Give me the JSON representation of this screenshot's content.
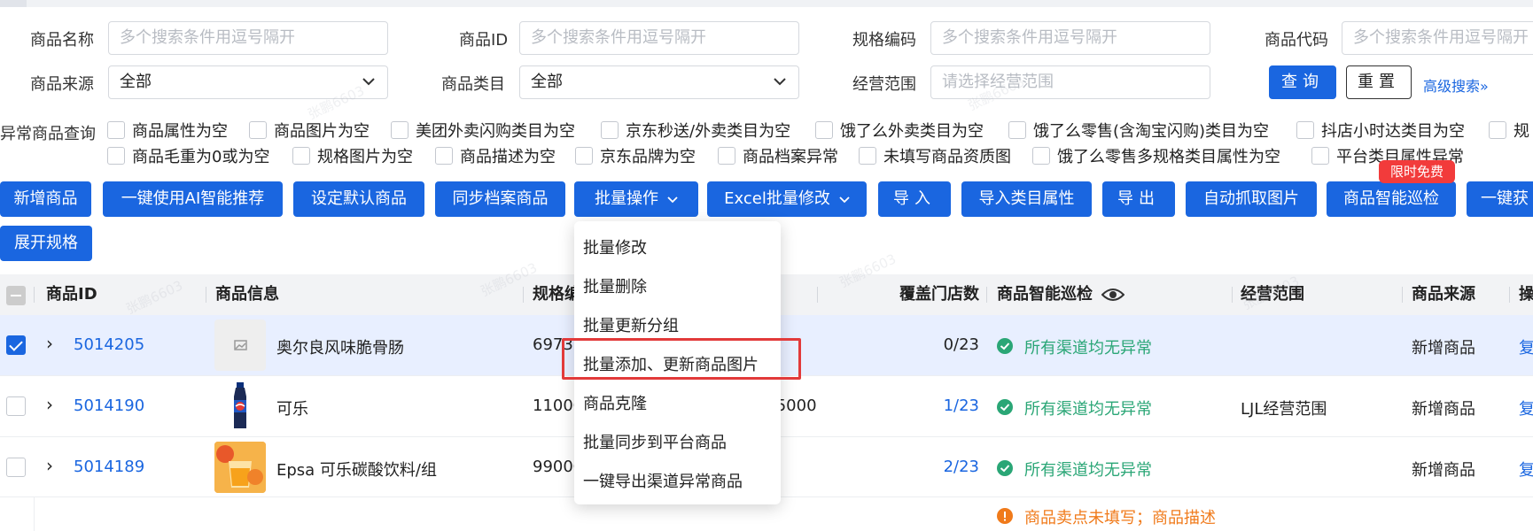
{
  "filters": {
    "row1": [
      {
        "label": "商品名称",
        "placeholder": "多个搜索条件用逗号隔开"
      },
      {
        "label": "商品ID",
        "placeholder": "多个搜索条件用逗号隔开"
      },
      {
        "label": "规格编码",
        "placeholder": "多个搜索条件用逗号隔开"
      },
      {
        "label": "商品代码",
        "placeholder": "多个搜索条件用逗号隔开"
      }
    ],
    "row2": {
      "source_label": "商品来源",
      "source_value": "全部",
      "category_label": "商品类目",
      "category_value": "全部",
      "scope_label": "经营范围",
      "scope_placeholder": "请选择经营范围"
    },
    "query_button": "查询",
    "reset_button": "重置",
    "advanced_search": "高级搜索"
  },
  "abnormal": {
    "label": "异常商品查询",
    "row1": [
      "商品属性为空",
      "商品图片为空",
      "美团外卖闪购类目为空",
      "京东秒送/外卖类目为空",
      "饿了么外卖类目为空",
      "饿了么零售(含淘宝闪购)类目为空",
      "抖店小时达类目为空",
      "规"
    ],
    "row2": [
      "商品毛重为0或为空",
      "规格图片为空",
      "商品描述为空",
      "京东品牌为空",
      "商品档案异常",
      "未填写商品资质图",
      "饿了么零售多规格类目属性为空",
      "平台类目属性异常"
    ]
  },
  "actions": {
    "buttons": [
      "新增商品",
      "一键使用AI智能推荐",
      "设定默认商品",
      "同步档案商品",
      "批量操作",
      "Excel批量修改",
      "导入",
      "导入类目属性",
      "导出",
      "自动抓取图片",
      "商品智能巡检",
      "一键获"
    ],
    "badge": "限时免费",
    "expand_spec": "展开规格"
  },
  "table": {
    "headers": {
      "id": "商品ID",
      "info": "商品信息",
      "spec": "规格编",
      "cover": "覆盖门店数",
      "inspect": "商品智能巡检",
      "scope": "经营范围",
      "source": "商品来源",
      "op": "操"
    },
    "rows": [
      {
        "id": "5014205",
        "name": "奥尔良风味脆骨肠",
        "spec": "6973",
        "spec_extra": "",
        "cover": "0/23",
        "status": "所有渠道均无异常",
        "scope": "",
        "source": "新增商品",
        "op": "复",
        "selected": true
      },
      {
        "id": "5014190",
        "name": "可乐",
        "spec": "1100C",
        "spec_extra": ",5000",
        "cover": "1/23",
        "status": "所有渠道均无异常",
        "scope": "LJL经营范围",
        "source": "新增商品",
        "op": "复",
        "selected": false
      },
      {
        "id": "5014189",
        "name": "Epsa 可乐碳酸饮料/组",
        "spec": "9900C",
        "spec_extra": "",
        "cover": "2/23",
        "status": "所有渠道均无异常",
        "scope": "",
        "source": "新增商品",
        "op": "复",
        "selected": false
      }
    ],
    "warning": "商品卖点未填写；商品描述"
  },
  "dropdown_menu": {
    "items": [
      "批量修改",
      "批量删除",
      "批量更新分组",
      "批量添加、更新商品图片",
      "商品克隆",
      "批量同步到平台商品",
      "一键导出渠道异常商品"
    ],
    "highlighted_index": 3
  },
  "watermark": "张鹏6603",
  "colors": {
    "primary": "#1a66e0",
    "success": "#2aa676",
    "warning": "#f07a1a",
    "badge": "#f23b3b",
    "highlight_box": "#e23a3a"
  }
}
